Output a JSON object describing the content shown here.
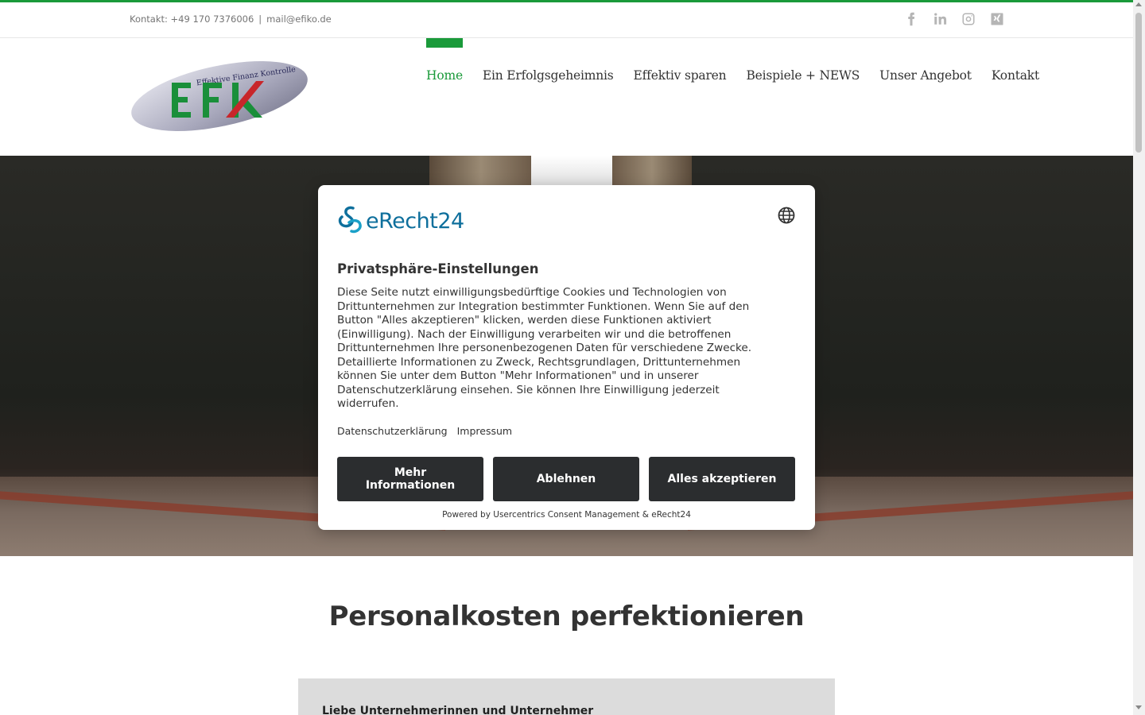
{
  "topbar": {
    "contact_phone": "Kontakt: +49 170 7376006",
    "separator": "|",
    "contact_email": "mail@efiko.de",
    "social_icons": [
      "facebook-icon",
      "linkedin-icon",
      "instagram-icon",
      "xing-icon"
    ]
  },
  "logo": {
    "tagline": "Effektive Finanz Kontrolle",
    "letters": "EFK"
  },
  "nav": {
    "items": [
      {
        "label": "Home",
        "active": true
      },
      {
        "label": "Ein Erfolgsgeheimnis",
        "active": false
      },
      {
        "label": "Effektiv sparen",
        "active": false
      },
      {
        "label": "Beispiele + NEWS",
        "active": false
      },
      {
        "label": "Unser Angebot",
        "active": false
      },
      {
        "label": "Kontakt",
        "active": false
      }
    ]
  },
  "consent": {
    "brand": "eRecht24",
    "title": "Privatsphäre-Einstellungen",
    "description": "Diese Seite nutzt einwilligungsbedürftige Cookies und Technologien von Drittunternehmen zur Integration bestimmter Funktionen. Wenn Sie auf den Button \"Alles akzeptieren\" klicken, werden diese Funktionen aktiviert (Einwilligung). Nach der Einwilligung verarbeiten wir und die betroffenen Drittunternehmen Ihre personenbezogenen Daten für verschiedene Zwecke. Detaillierte Informationen zu Zweck, Rechtsgrundlagen, Drittunternehmen können Sie unter dem Button \"Mehr Informationen\" und in unserer Datenschutzerklärung einsehen. Sie können Ihre Einwilligung jederzeit widerrufen.",
    "link_privacy": "Datenschutzerklärung",
    "link_imprint": "Impressum",
    "btn_more": "Mehr Informationen",
    "btn_decline": "Ablehnen",
    "btn_accept": "Alles akzeptieren",
    "powered_by": "Powered by Usercentrics Consent Management & eRecht24"
  },
  "content": {
    "heading": "Personalkosten perfektionieren",
    "box_text": "Liebe Unternehmerinnen und Unternehmer"
  },
  "colors": {
    "accent": "#1a9a3a",
    "button_dark": "#2b2d2f",
    "brand_blue": "#0e6f9c"
  }
}
